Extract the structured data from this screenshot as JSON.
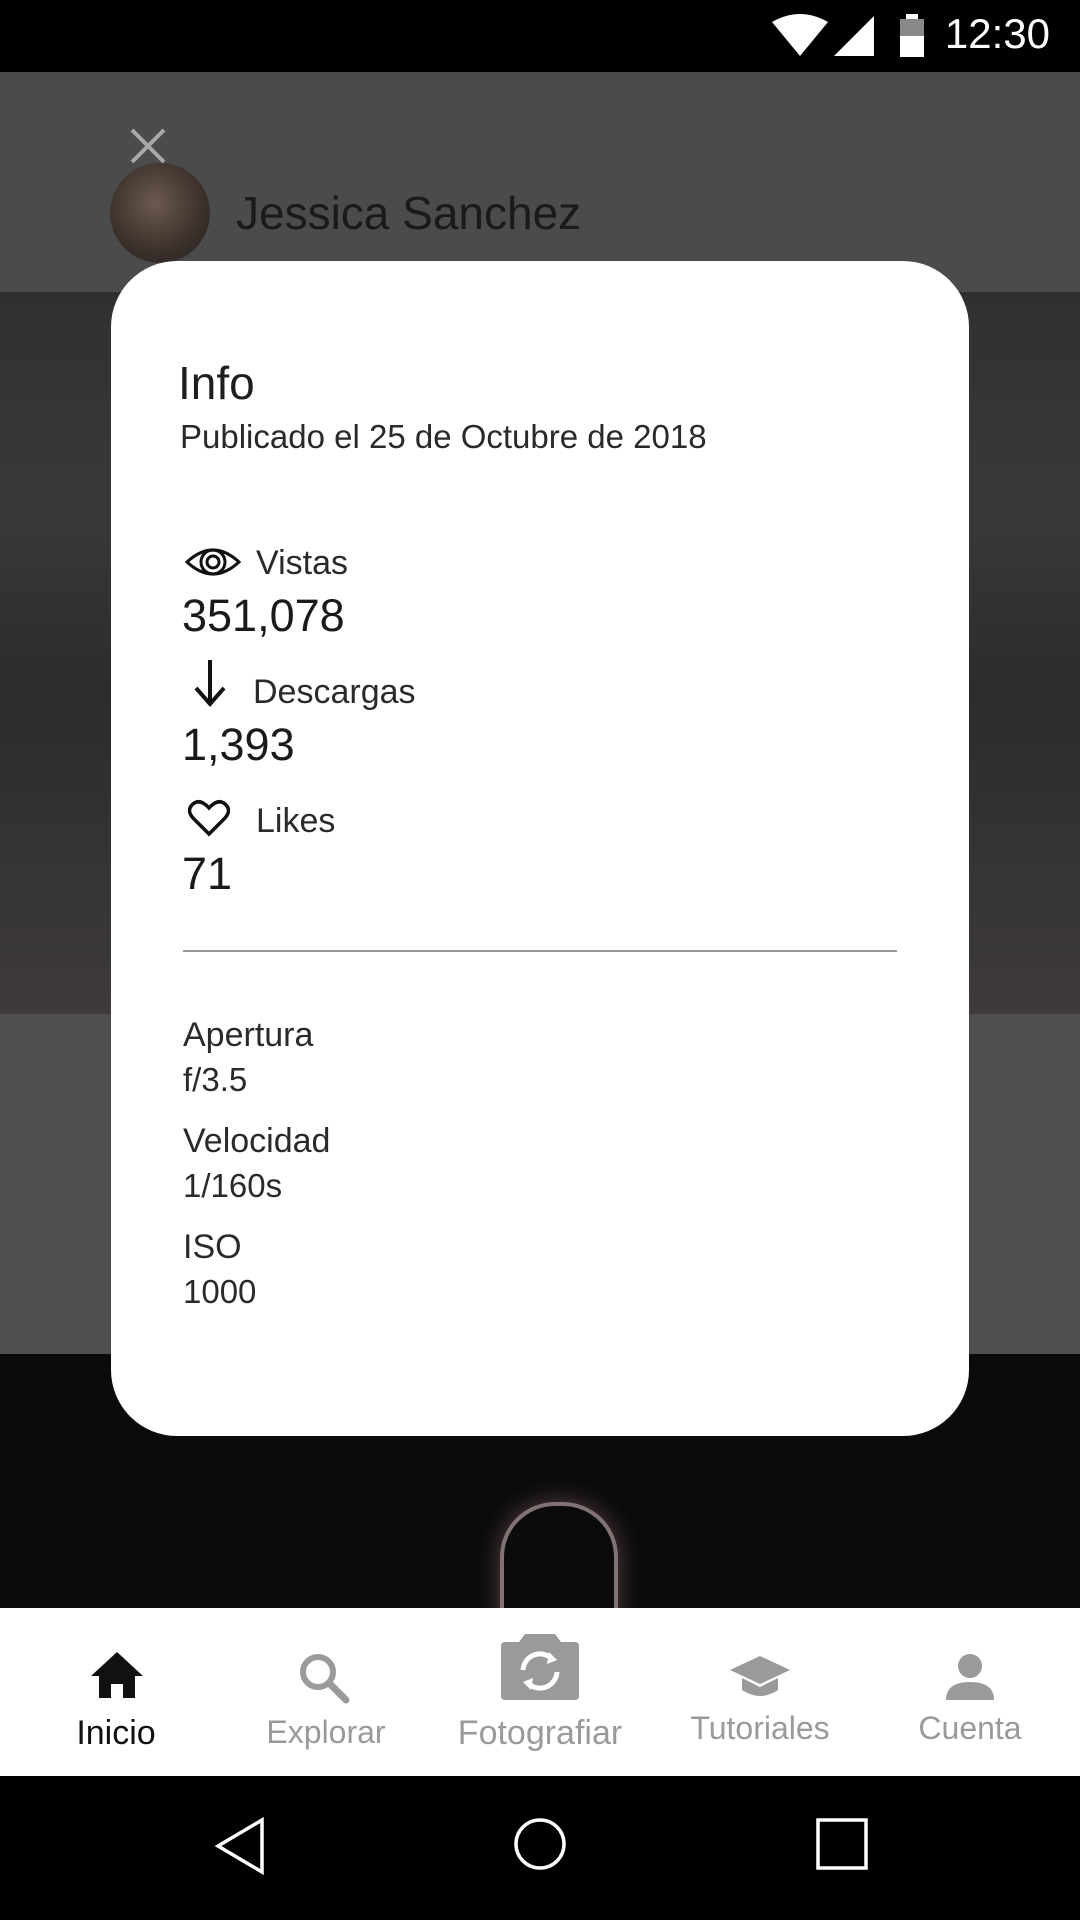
{
  "status_bar": {
    "time": "12:30"
  },
  "header": {
    "user_name": "Jessica Sanchez"
  },
  "info": {
    "title": "Info",
    "published": "Publicado el 25 de Octubre de 2018",
    "stats": [
      {
        "icon": "eye-icon",
        "label": "Vistas",
        "value": "351,078"
      },
      {
        "icon": "download-arrow-icon",
        "label": "Descargas",
        "value": "1,393"
      },
      {
        "icon": "heart-icon",
        "label": "Likes",
        "value": "71"
      }
    ],
    "exif": [
      {
        "label": "Apertura",
        "value": "f/3.5"
      },
      {
        "label": "Velocidad",
        "value": "1/160s"
      },
      {
        "label": "ISO",
        "value": "1000"
      }
    ]
  },
  "bottom_nav": {
    "items": [
      {
        "icon": "home-icon",
        "label": "Inicio",
        "active": true
      },
      {
        "icon": "search-icon",
        "label": "Explorar",
        "active": false
      },
      {
        "icon": "camera-switch-icon",
        "label": "Fotografiar",
        "active": false
      },
      {
        "icon": "graduation-cap-icon",
        "label": "Tutoriales",
        "active": false
      },
      {
        "icon": "user-icon",
        "label": "Cuenta",
        "active": false
      }
    ]
  },
  "colors": {
    "overlay": "#4f4f4f",
    "card": "#ffffff",
    "active_nav": "#111111",
    "inactive_nav": "#9a9a9a"
  }
}
